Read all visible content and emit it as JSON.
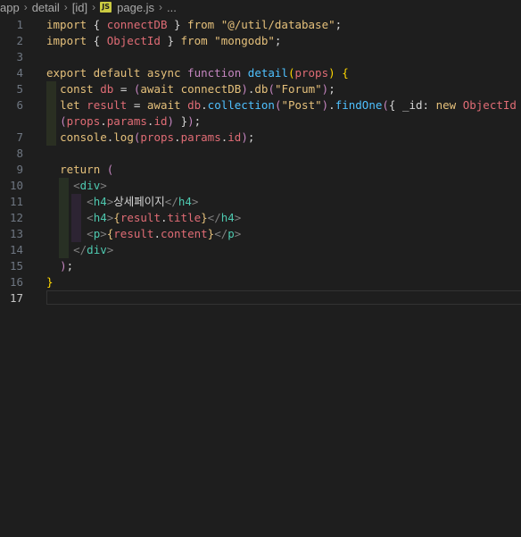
{
  "breadcrumb": {
    "items": [
      "app",
      "detail",
      "[id]",
      "page.js",
      "..."
    ],
    "file_icon": "JS"
  },
  "editor": {
    "active_line": 17,
    "lines": [
      {
        "n": "1",
        "text": "import { connectDB } from \"@/util/database\";"
      },
      {
        "n": "2",
        "text": "import { ObjectId } from \"mongodb\";"
      },
      {
        "n": "3",
        "text": ""
      },
      {
        "n": "4",
        "text": "export default async function detail(props) {"
      },
      {
        "n": "5",
        "text": "  const db = (await connectDB).db(\"Forum\");"
      },
      {
        "n": "6",
        "text": "  let result = await db.collection(\"Post\").findOne({ _id: new ObjectId"
      },
      {
        "n": "",
        "text": "  (props.params.id) });"
      },
      {
        "n": "7",
        "text": "  console.log(props.params.id);"
      },
      {
        "n": "8",
        "text": ""
      },
      {
        "n": "9",
        "text": "  return ("
      },
      {
        "n": "10",
        "text": "    <div>"
      },
      {
        "n": "11",
        "text": "      <h4>상세페이지</h4>"
      },
      {
        "n": "12",
        "text": "      <h4>{result.title}</h4>"
      },
      {
        "n": "13",
        "text": "      <p>{result.content}</p>"
      },
      {
        "n": "14",
        "text": "    </div>"
      },
      {
        "n": "15",
        "text": "  );"
      },
      {
        "n": "16",
        "text": "}"
      },
      {
        "n": "17",
        "text": ""
      }
    ]
  }
}
